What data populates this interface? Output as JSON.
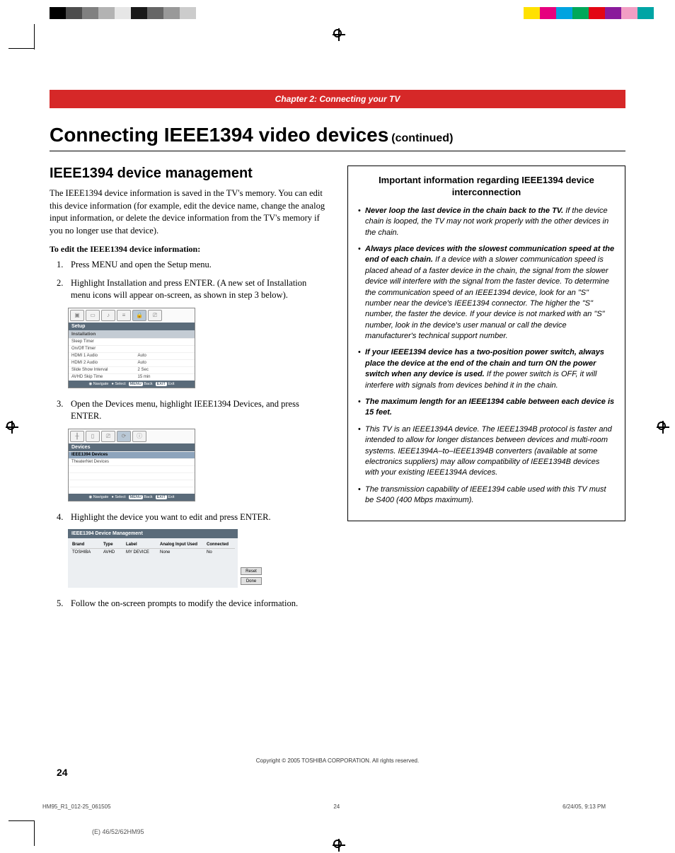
{
  "chapter": "Chapter 2: Connecting your TV",
  "title": "Connecting IEEE1394 video devices",
  "continued": "(continued)",
  "section": "IEEE1394 device management",
  "intro": "The IEEE1394 device information is saved in the TV's memory. You can edit this device information (for example, edit the device name, change the analog input information, or delete the device information from the TV's memory if you no longer use that device).",
  "edit_heading": "To edit the IEEE1394 device information:",
  "steps": [
    "Press MENU and open the Setup menu.",
    "Highlight Installation and press ENTER. (A new set of Installation menu icons will appear on-screen, as shown in step 3 below).",
    "Open the Devices menu, highlight IEEE1394 Devices, and press ENTER.",
    "Highlight the device you want to edit and press ENTER.",
    "Follow the on-screen prompts to modify the device information."
  ],
  "osd1": {
    "title": "Setup",
    "sub": "Installation",
    "rows": [
      {
        "k": "Sleep Timer",
        "v": ""
      },
      {
        "k": "On/Off Timer",
        "v": ""
      },
      {
        "k": "HDMI 1 Audio",
        "v": "Auto"
      },
      {
        "k": "HDMI 2 Audio",
        "v": "Auto"
      },
      {
        "k": "Slide Show Interval",
        "v": "2 Sec"
      },
      {
        "k": "AVHD Skip Time",
        "v": "15 min"
      }
    ],
    "footer": [
      "Navigate",
      "Select",
      "Back",
      "Exit"
    ],
    "footer_badges": [
      "MENU",
      "EXIT"
    ]
  },
  "osd2": {
    "title": "Devices",
    "rows": [
      {
        "k": "IEEE1394 Devices"
      },
      {
        "k": "TheaterNet Devices"
      }
    ],
    "footer": [
      "Navigate",
      "Select",
      "Back",
      "Exit"
    ],
    "footer_badges": [
      "MENU",
      "EXIT"
    ]
  },
  "osd3": {
    "title": "IEEE1394 Device Management",
    "head": [
      "Brand",
      "Type",
      "Label",
      "Analog Input Used",
      "Connected"
    ],
    "row": [
      "TOSHIBA",
      "AVHD",
      "MY DEVICE",
      "None",
      "No"
    ],
    "buttons": [
      "Reset",
      "Done"
    ]
  },
  "callout": {
    "title": "Important information regarding IEEE1394 device interconnection",
    "items": [
      {
        "lead": "Never loop the last device in the chain back to the TV.",
        "rest": " If the device chain is looped, the TV may not work properly with the other devices in the chain."
      },
      {
        "lead": "Always place devices with the slowest communication speed at the end of each chain.",
        "rest": " If a device with a slower communication speed is placed ahead of a faster device in the chain, the signal from the slower device will interfere with the signal from the faster device. To determine the communication speed of an IEEE1394 device, look for an \"S\" number near the device's IEEE1394 connector. The higher the \"S\" number, the faster the device. If your device is not marked with an \"S\" number, look in the device's user manual or call the device manufacturer's technical support number."
      },
      {
        "lead": "If your IEEE1394 device has a two-position power switch, always place the device at the end of the chain and turn ON the power switch when any device is used.",
        "rest": " If the power switch is OFF, it will interfere with signals from devices behind it in the chain."
      },
      {
        "lead": "The maximum length for an IEEE1394 cable between each device is 15 feet.",
        "rest": ""
      },
      {
        "lead": "",
        "rest": "This TV is an IEEE1394A device. The IEEE1394B protocol is faster and intended to allow for longer distances between devices and multi-room systems. IEEE1394A–to–IEEE1394B converters (available at some electronics suppliers) may allow compatibility of IEEE1394B devices with your existing IEEE1394A devices."
      },
      {
        "lead": "",
        "rest": "The transmission capability of IEEE1394 cable used with this TV must be S400 (400 Mbps maximum)."
      }
    ]
  },
  "copyright": "Copyright © 2005 TOSHIBA CORPORATION. All rights reserved.",
  "pagenum": "24",
  "slug_left": "HM95_R1_012-25_061505",
  "slug_mid": "24",
  "slug_right": "6/24/05, 9:13 PM",
  "model": "(E) 46/52/62HM95",
  "colors": {
    "left": [
      "#000000",
      "#4d4d4d",
      "#808080",
      "#b3b3b3",
      "#e6e6e6",
      "#1a1a1a",
      "#666666",
      "#999999",
      "#cccccc"
    ],
    "right": [
      "#ffe100",
      "#e6007e",
      "#00a3e0",
      "#00a859",
      "#e30613",
      "#8a1a9b",
      "#f29ec4",
      "#00a5a5"
    ]
  }
}
